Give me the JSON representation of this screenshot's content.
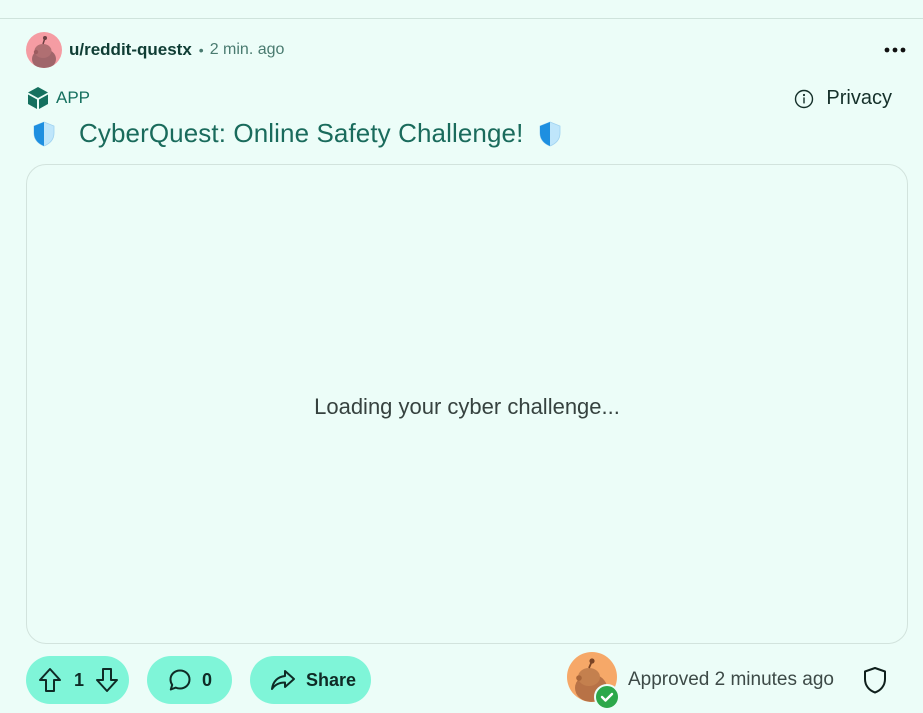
{
  "post": {
    "author": "u/reddit-questx",
    "separator": "•",
    "time": "2 min. ago",
    "app_label": "APP",
    "privacy_label": "Privacy",
    "title": "CyberQuest: Online Safety Challenge!"
  },
  "embed": {
    "loading_text": "Loading your cyber challenge..."
  },
  "actions": {
    "vote_count": "1",
    "comment_count": "0",
    "share_label": "Share"
  },
  "moderation": {
    "approved_text": "Approved 2 minutes ago"
  },
  "colors": {
    "background": "#ecfdf8",
    "accent": "#7ff5d8",
    "title": "#1a6b5c",
    "app_badge": "#15705f"
  },
  "icons": {
    "author_avatar": "snoo-avatar-icon",
    "more": "more-horizontal-icon",
    "app": "app-cube-icon",
    "info": "info-icon",
    "title_shield": "shield-icon",
    "upvote": "upvote-arrow-icon",
    "downvote": "downvote-arrow-icon",
    "comment": "comment-bubble-icon",
    "share": "share-arrow-icon",
    "mod_avatar": "moderator-avatar-icon",
    "approved_check": "check-badge-icon",
    "mod_shield": "mod-shield-icon"
  }
}
